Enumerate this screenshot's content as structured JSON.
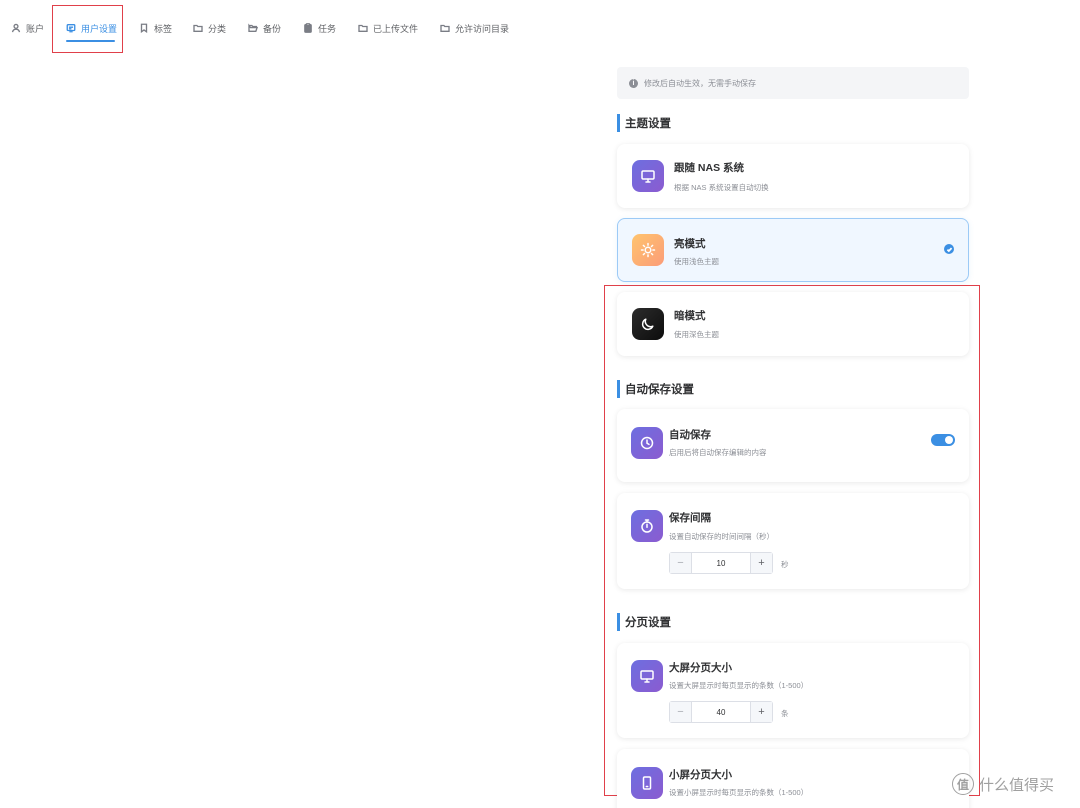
{
  "tabs": [
    {
      "label": "账户",
      "icon": "user-icon"
    },
    {
      "label": "用户设置",
      "icon": "user-settings-icon",
      "active": true
    },
    {
      "label": "标签",
      "icon": "bookmark-icon"
    },
    {
      "label": "分类",
      "icon": "folder-icon"
    },
    {
      "label": "备份",
      "icon": "folder-open-icon"
    },
    {
      "label": "任务",
      "icon": "clipboard-icon"
    },
    {
      "label": "已上传文件",
      "icon": "folder-icon"
    },
    {
      "label": "允许访问目录",
      "icon": "folder-icon"
    }
  ],
  "notice": {
    "icon": "info-icon",
    "text": "修改后自动生效，无需手动保存"
  },
  "theme": {
    "title": "主题设置",
    "options": [
      {
        "title": "跟随 NAS 系统",
        "desc": "根据 NAS 系统设置自动切换",
        "icon": "monitor-icon"
      },
      {
        "title": "亮模式",
        "desc": "使用浅色主题",
        "icon": "sun-icon",
        "selected": true
      },
      {
        "title": "暗模式",
        "desc": "使用深色主题",
        "icon": "moon-icon"
      }
    ]
  },
  "autosave": {
    "title": "自动保存设置",
    "toggle_card": {
      "title": "自动保存",
      "desc": "启用后将自动保存编辑的内容",
      "icon": "clock-icon",
      "enabled": true
    },
    "interval_card": {
      "title": "保存间隔",
      "desc": "设置自动保存的时间间隔（秒）",
      "icon": "stopwatch-icon",
      "value": "10",
      "unit": "秒"
    }
  },
  "pagination": {
    "title": "分页设置",
    "large": {
      "title": "大屏分页大小",
      "desc": "设置大屏显示时每页显示的条数（1-500）",
      "icon": "monitor-icon",
      "value": "40",
      "unit": "条"
    },
    "small": {
      "title": "小屏分页大小",
      "desc": "设置小屏显示时每页显示的条数（1-500）",
      "icon": "tablet-icon"
    }
  },
  "stepper": {
    "minus": "−",
    "plus": "+"
  },
  "watermark": {
    "logo": "值",
    "text": "什么值得买"
  },
  "colors": {
    "accent": "#3b8fe3",
    "highlight_box": "#e0404a"
  }
}
